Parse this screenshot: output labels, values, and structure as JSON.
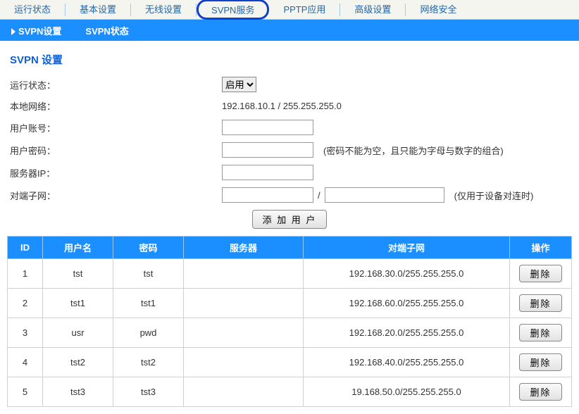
{
  "topnav": {
    "items": [
      "运行状态",
      "基本设置",
      "无线设置",
      "SVPN服务",
      "PPTP应用",
      "高级设置",
      "网络安全"
    ],
    "active_index": 3
  },
  "subnav": {
    "items": [
      "SVPN设置",
      "SVPN状态"
    ]
  },
  "page": {
    "title": "SVPN 设置"
  },
  "form": {
    "status_label": "运行状态：",
    "status_value": "启用",
    "local_net_label": "本地网络：",
    "local_net_value": "192.168.10.1 / 255.255.255.0",
    "user_label": "用户账号：",
    "pwd_label": "用户密码：",
    "pwd_hint": "(密码不能为空，且只能为字母与数字的组合)",
    "server_label": "服务器IP：",
    "subnet_label": "对端子网：",
    "subnet_sep": "/",
    "subnet_hint": "(仅用于设备对连时)",
    "add_btn": "添 加 用 户"
  },
  "table": {
    "headers": {
      "id": "ID",
      "user": "用户名",
      "pwd": "密码",
      "server": "服务器",
      "subnet": "对端子网",
      "op": "操作"
    },
    "delete_label": "删除",
    "rows": [
      {
        "id": "1",
        "user": "tst",
        "pwd": "tst",
        "server": "",
        "subnet": "192.168.30.0/255.255.255.0"
      },
      {
        "id": "2",
        "user": "tst1",
        "pwd": "tst1",
        "server": "",
        "subnet": "192.168.60.0/255.255.255.0"
      },
      {
        "id": "3",
        "user": "usr",
        "pwd": "pwd",
        "server": "",
        "subnet": "192.168.20.0/255.255.255.0"
      },
      {
        "id": "4",
        "user": "tst2",
        "pwd": "tst2",
        "server": "",
        "subnet": "192.168.40.0/255.255.255.0"
      },
      {
        "id": "5",
        "user": "tst3",
        "pwd": "tst3",
        "server": "",
        "subnet": "19.168.50.0/255.255.255.0"
      }
    ]
  }
}
